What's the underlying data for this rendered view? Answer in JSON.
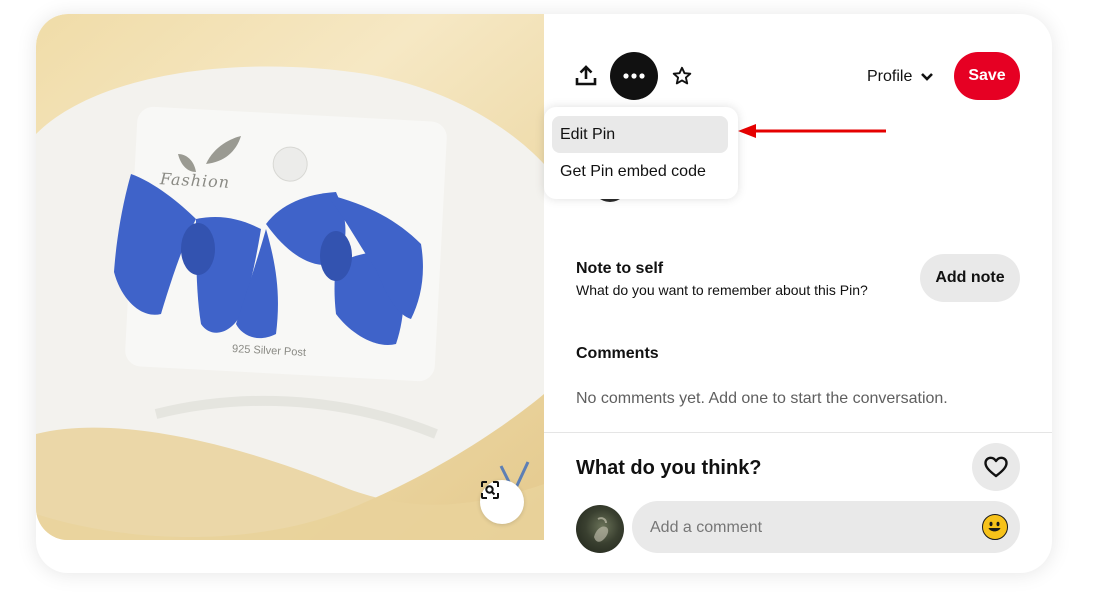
{
  "header": {
    "share_icon": "share-upload-icon",
    "more_icon": "ellipsis-icon",
    "star_icon": "star-icon",
    "profile_label": "Profile",
    "profile_icon": "chevron-down-icon",
    "save_label": "Save",
    "save_color": "#e60023"
  },
  "menu": {
    "items": [
      {
        "label": "Edit Pin"
      },
      {
        "label": "Get Pin embed code"
      }
    ]
  },
  "image": {
    "card_text": "Fashion",
    "card_bottom_text": "925 Silver Post",
    "lens_icon": "visual-search-icon"
  },
  "note": {
    "title": "Note to self",
    "subtitle": "What do you want to remember about this Pin?",
    "button_label": "Add note"
  },
  "comments": {
    "title": "Comments",
    "empty_text": "No comments yet. Add one to start the conversation."
  },
  "footer": {
    "prompt": "What do you think?",
    "heart_icon": "heart-icon",
    "input_placeholder": "Add a comment",
    "emoji_icon": "smiley-emoji-icon"
  },
  "annotation": {
    "arrow_color": "#e50000"
  }
}
